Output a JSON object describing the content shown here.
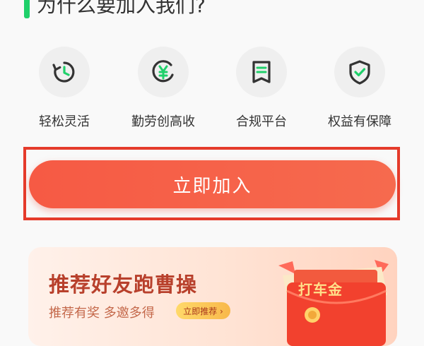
{
  "section": {
    "title": "为什么要加入我们?"
  },
  "features": [
    {
      "label": "轻松灵活",
      "icon": "clock-icon"
    },
    {
      "label": "勤劳创高收",
      "icon": "yen-icon"
    },
    {
      "label": "合规平台",
      "icon": "document-icon"
    },
    {
      "label": "权益有保障",
      "icon": "shield-check-icon"
    }
  ],
  "join": {
    "label": "立即加入"
  },
  "referral": {
    "title": "推荐好友跑曹操",
    "subtitle": "推荐有奖 多邀多得",
    "button_label": "立即推荐 ›",
    "badge_text": "打车金"
  },
  "colors": {
    "accent_green": "#1fd06a",
    "button_red": "#f65a44",
    "highlight_border": "#e53b2b"
  }
}
